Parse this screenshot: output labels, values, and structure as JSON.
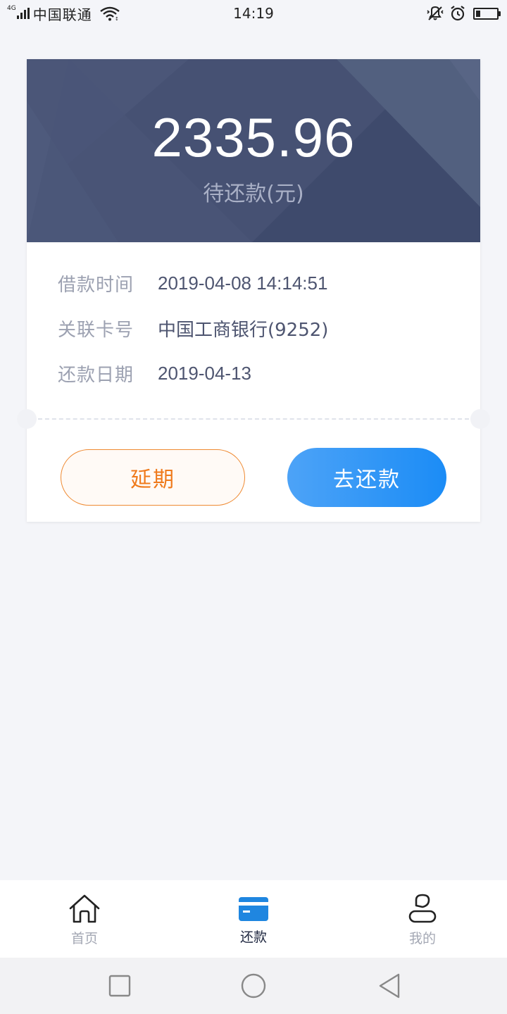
{
  "status_bar": {
    "network_type": "4G",
    "carrier": "中国联通",
    "time": "14:19",
    "battery_level": 0.2
  },
  "loan": {
    "amount": "2335.96",
    "amount_label": "待还款(元)",
    "details": [
      {
        "label": "借款时间",
        "value": "2019-04-08 14:14:51"
      },
      {
        "label": "关联卡号",
        "value": "中国工商银行(9252)"
      },
      {
        "label": "还款日期",
        "value": "2019-04-13"
      }
    ],
    "extend_button": "延期",
    "repay_button": "去还款"
  },
  "tabs": [
    {
      "label": "首页",
      "icon": "home-icon",
      "active": false
    },
    {
      "label": "还款",
      "icon": "card-icon",
      "active": true
    },
    {
      "label": "我的",
      "icon": "user-icon",
      "active": false
    }
  ],
  "colors": {
    "header_bg": "#465173",
    "accent_blue": "#1b8cf6",
    "accent_orange": "#ef7a1c",
    "page_bg": "#f4f5f9"
  }
}
